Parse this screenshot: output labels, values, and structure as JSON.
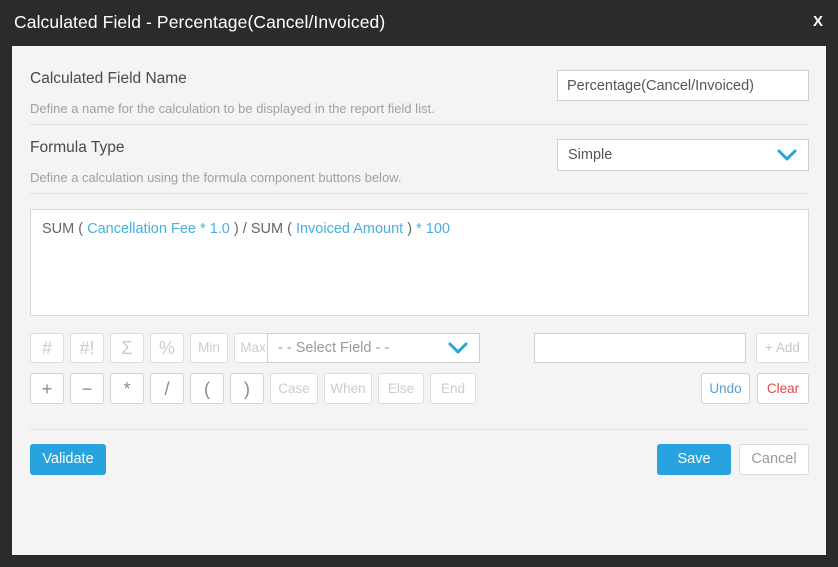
{
  "window": {
    "title": "Calculated Field - Percentage(Cancel/Invoiced)",
    "close_label": "X"
  },
  "colors": {
    "titlebar_bg": "#2b2b2b",
    "body_bg": "#f4f4f4",
    "accent": "#29a3e0",
    "token_blue": "#45b0e3",
    "clear_red": "#e04a4a",
    "undo_blue": "#5a9fd4"
  },
  "fields": {
    "name": {
      "label": "Calculated Field Name",
      "help": "Define a name for the calculation to be displayed in the report field list.",
      "value": "Percentage(Cancel/Invoiced)",
      "placeholder": ""
    },
    "formula_type": {
      "label": "Formula Type",
      "help": "Define a calculation using the formula component buttons below.",
      "value": "Simple"
    }
  },
  "formula": {
    "text": "SUM ( Cancellation Fee * 1.0 ) / SUM ( Invoiced Amount ) * 100",
    "tokens": [
      {
        "t": "SUM",
        "k": "plain"
      },
      {
        "t": "(",
        "k": "plain"
      },
      {
        "t": "Cancellation Fee",
        "k": "field"
      },
      {
        "t": "*",
        "k": "op"
      },
      {
        "t": "1.0",
        "k": "num"
      },
      {
        "t": ")",
        "k": "plain"
      },
      {
        "t": "/",
        "k": "plain"
      },
      {
        "t": "SUM",
        "k": "plain"
      },
      {
        "t": "(",
        "k": "plain"
      },
      {
        "t": "Invoiced Amount",
        "k": "field"
      },
      {
        "t": ")",
        "k": "plain"
      },
      {
        "t": "*",
        "k": "op"
      },
      {
        "t": "100",
        "k": "num"
      }
    ]
  },
  "toolbar": {
    "row1": [
      {
        "label": "#",
        "name": "count-button",
        "enabled": false
      },
      {
        "label": "#!",
        "name": "count-distinct-button",
        "enabled": false
      },
      {
        "label": "Σ",
        "name": "sum-button",
        "enabled": false
      },
      {
        "label": "%",
        "name": "percent-button",
        "enabled": false
      },
      {
        "label": "Min",
        "name": "min-button",
        "enabled": false
      },
      {
        "label": "Max",
        "name": "max-button",
        "enabled": false
      }
    ],
    "row2": [
      {
        "label": "+",
        "name": "plus-button",
        "enabled": true
      },
      {
        "label": "−",
        "name": "minus-button",
        "enabled": true
      },
      {
        "label": "*",
        "name": "multiply-button",
        "enabled": true
      },
      {
        "label": "/",
        "name": "divide-button",
        "enabled": true
      },
      {
        "label": "(",
        "name": "open-paren-button",
        "enabled": true
      },
      {
        "label": ")",
        "name": "close-paren-button",
        "enabled": true
      },
      {
        "label": "Case",
        "name": "case-button",
        "enabled": false
      },
      {
        "label": "When",
        "name": "when-button",
        "enabled": false
      },
      {
        "label": "Else",
        "name": "else-button",
        "enabled": false
      },
      {
        "label": "End",
        "name": "end-button",
        "enabled": false
      }
    ],
    "select_field": {
      "placeholder": "- - Select Field - -",
      "value": ""
    },
    "constant_input": {
      "value": "",
      "placeholder": ""
    },
    "add_label": "+ Add",
    "undo_label": "Undo",
    "clear_label": "Clear"
  },
  "actions": {
    "validate_label": "Validate",
    "save_label": "Save",
    "cancel_label": "Cancel"
  }
}
